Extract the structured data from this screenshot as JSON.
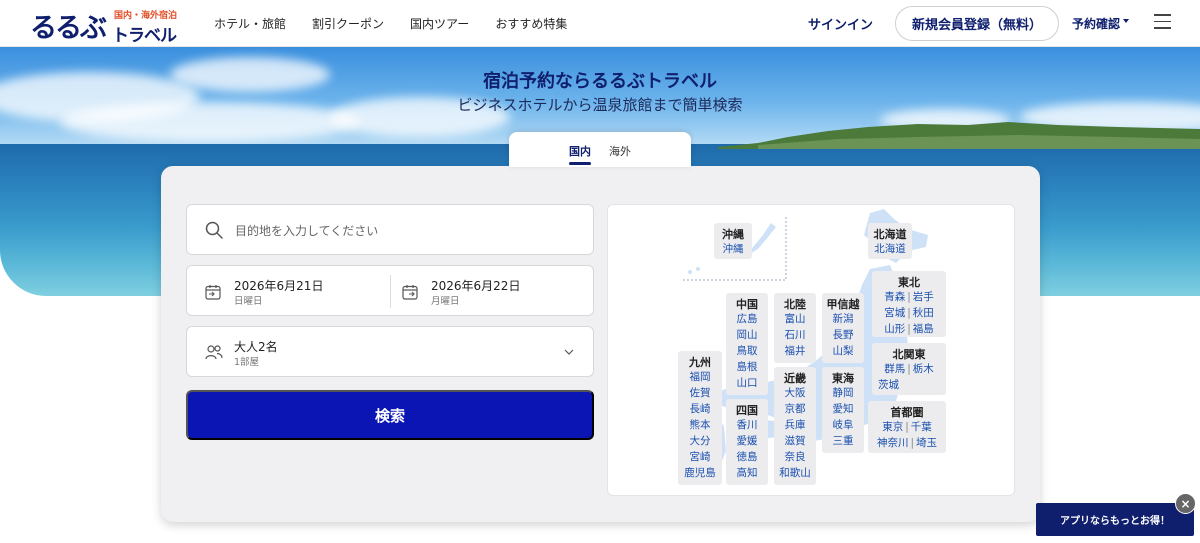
{
  "header": {
    "logo_main": "るるぶ",
    "logo_travel": "トラベル",
    "logo_sub": "国内・海外宿泊",
    "nav": [
      "ホテル・旅館",
      "割引クーポン",
      "国内ツアー",
      "おすすめ特集"
    ],
    "signin": "サインイン",
    "register": "新規会員登録（無料）",
    "booking": "予約確認"
  },
  "hero": {
    "title": "宿泊予約ならるるぶトラベル",
    "subtitle": "ビジネスホテルから温泉旅館まで簡単検索"
  },
  "tabs": [
    {
      "label": "国内",
      "active": true
    },
    {
      "label": "海外",
      "active": false
    }
  ],
  "search": {
    "destination_placeholder": "目的地を入力してください",
    "checkin_date": "2026年6月21日",
    "checkin_day": "日曜日",
    "checkout_date": "2026年6月22日",
    "checkout_day": "月曜日",
    "guests": "大人2名",
    "rooms": "1部屋",
    "button": "検索"
  },
  "map": {
    "regions": {
      "okinawa": {
        "name": "沖縄",
        "prefs": [
          "沖縄"
        ]
      },
      "hokkaido": {
        "name": "北海道",
        "prefs": [
          "北海道"
        ]
      },
      "tohoku": {
        "name": "東北",
        "rows": [
          [
            "青森",
            "岩手"
          ],
          [
            "宮城",
            "秋田"
          ],
          [
            "山形",
            "福島"
          ]
        ]
      },
      "kitakanto": {
        "name": "北関東",
        "rows": [
          [
            "群馬",
            "栃木"
          ],
          [
            "茨城"
          ]
        ]
      },
      "shutoken": {
        "name": "首都圏",
        "rows": [
          [
            "東京",
            "千葉"
          ],
          [
            "神奈川",
            "埼玉"
          ]
        ]
      },
      "chugoku": {
        "name": "中国",
        "prefs": [
          "広島",
          "岡山",
          "鳥取",
          "島根",
          "山口"
        ]
      },
      "hokuriku": {
        "name": "北陸",
        "prefs": [
          "富山",
          "石川",
          "福井"
        ]
      },
      "koshinetsu": {
        "name": "甲信越",
        "prefs": [
          "新潟",
          "長野",
          "山梨"
        ]
      },
      "kinki": {
        "name": "近畿",
        "prefs": [
          "大阪",
          "京都",
          "兵庫",
          "滋賀",
          "奈良",
          "和歌山"
        ]
      },
      "tokai": {
        "name": "東海",
        "prefs": [
          "静岡",
          "愛知",
          "岐阜",
          "三重"
        ]
      },
      "shikoku": {
        "name": "四国",
        "prefs": [
          "香川",
          "愛媛",
          "徳島",
          "高知"
        ]
      },
      "kyushu": {
        "name": "九州",
        "prefs": [
          "福岡",
          "佐賀",
          "長崎",
          "熊本",
          "大分",
          "宮崎",
          "鹿児島"
        ]
      }
    }
  },
  "app_banner": "アプリならもっとお得！",
  "close_label": "×",
  "colors": {
    "brand": "#0f1f6e",
    "button": "#0b15b4",
    "pref_link": "#1a4fae",
    "accent": "#e2502a"
  }
}
